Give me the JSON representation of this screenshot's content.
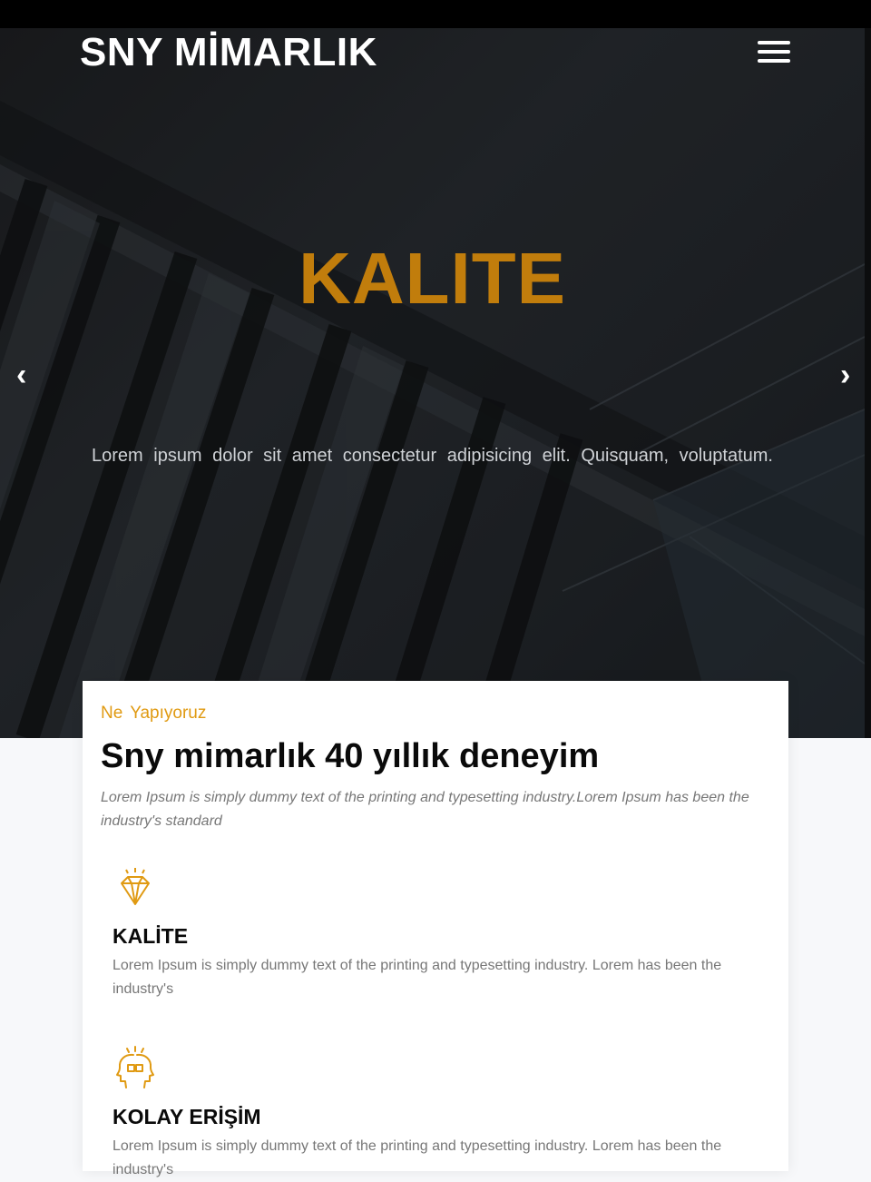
{
  "brand": {
    "name": "SNY MİMARLIK"
  },
  "nav": {
    "menu_icon": "hamburger-menu-icon"
  },
  "hero": {
    "title": "KALITE",
    "subtitle": "Lorem ipsum dolor sit amet consectetur adipisicing elit. Quisquam, voluptatum.",
    "prev_icon": "‹",
    "next_icon": "›"
  },
  "about": {
    "eyebrow": "Ne Yapıyoruz",
    "title": "Sny mimarlık 40 yıllık deneyim",
    "description": "Lorem Ipsum is simply dummy text of the printing and typesetting industry.Lorem Ipsum has been the industry's standard"
  },
  "features": [
    {
      "icon": "diamond-icon",
      "title": "KALİTE",
      "text": "Lorem Ipsum is simply dummy text of the printing and typesetting industry. Lorem has been the industry's"
    },
    {
      "icon": "heads-puzzle-icon",
      "title": "KOLAY ERİŞİM",
      "text": "Lorem Ipsum is simply dummy text of the printing and typesetting industry. Lorem has been the industry's"
    }
  ],
  "colors": {
    "accent": "#c17d0c",
    "eyebrow": "#e09a12",
    "topbar": "#000000"
  }
}
